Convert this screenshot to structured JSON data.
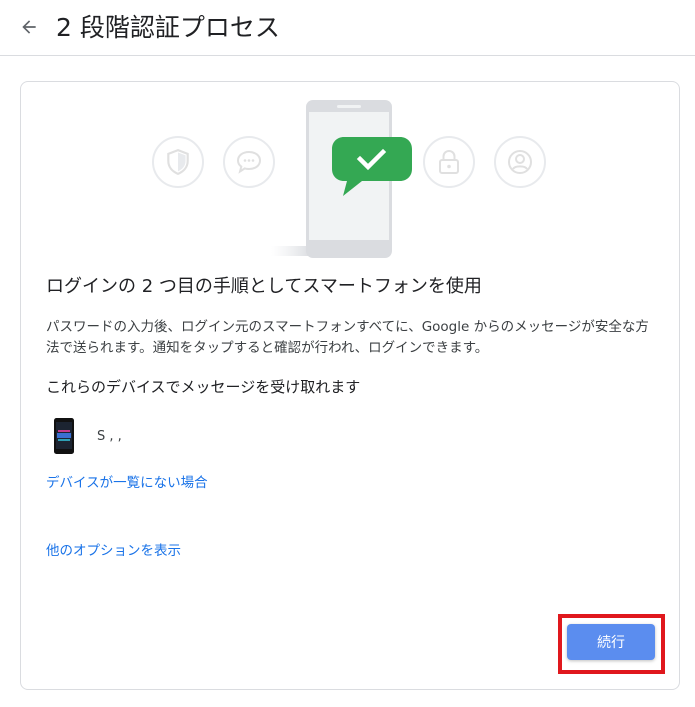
{
  "header": {
    "title": "2 段階認証プロセス",
    "back_icon": "arrow-back-icon"
  },
  "hero": {
    "icons": [
      "shield-icon",
      "chat-bubble-icon",
      "phone-with-check-icon",
      "lock-icon",
      "account-icon"
    ],
    "colors": {
      "accent_green": "#34a853",
      "ring": "#e8eaed",
      "phone": "#dadce0"
    }
  },
  "main": {
    "heading": "ログインの 2 つ目の手順としてスマートフォンを使用",
    "description": "パスワードの入力後、ログイン元のスマートフォンすべてに、Google からのメッセージが安全な方法で送られます。通知をタップすると確認が行われ、ログインできます。",
    "devices_heading": "これらのデバイスでメッセージを受け取れます",
    "devices": [
      {
        "name": "S  ,  ,",
        "icon": "smartphone-icon"
      }
    ],
    "device_missing_link": "デバイスが一覧にない場合",
    "more_options_link": "他のオプションを表示",
    "continue_label": "続行"
  },
  "colors": {
    "link": "#1a73e8",
    "button": "#5b8def",
    "highlight_border": "#e0181d"
  }
}
